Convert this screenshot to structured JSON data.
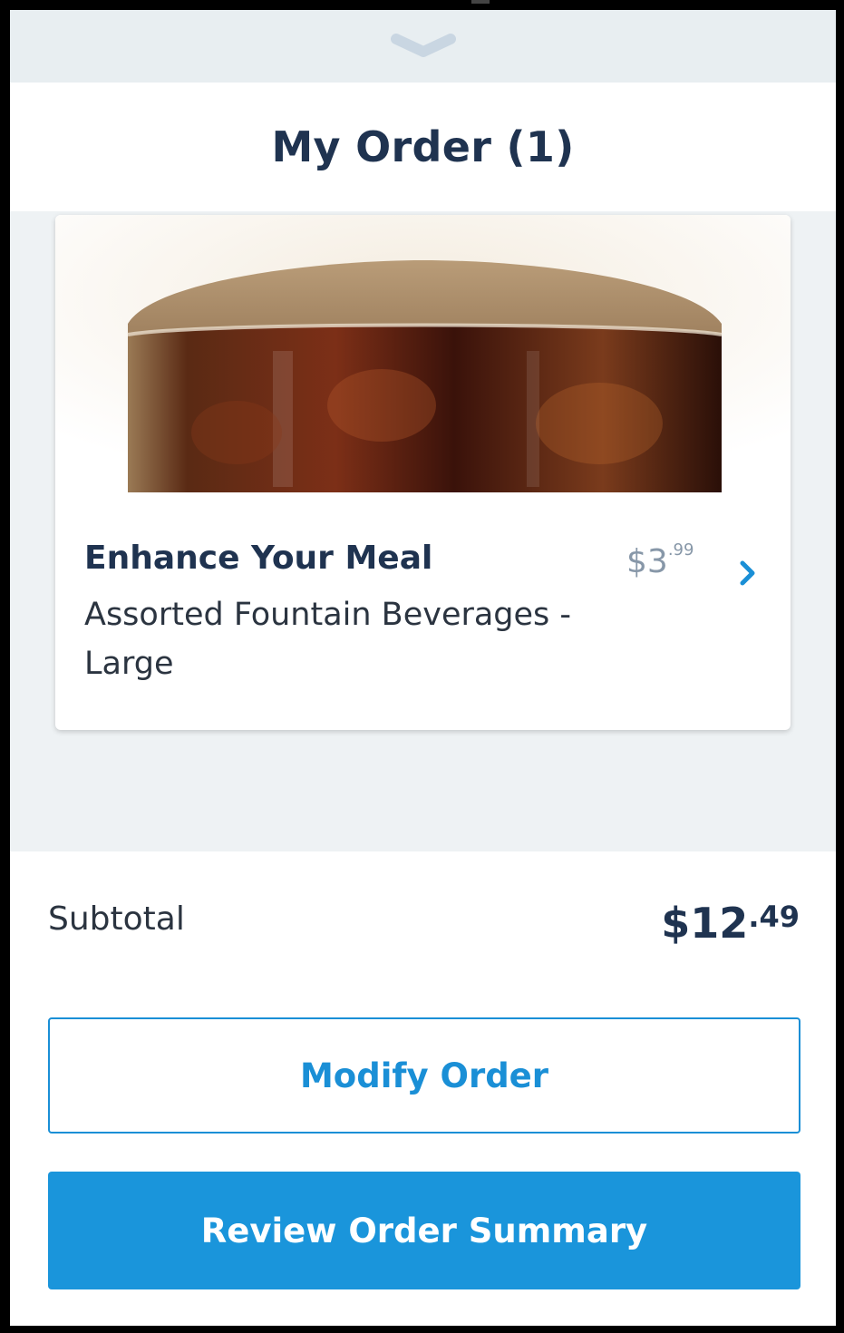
{
  "header": {
    "title": "My Order (1)"
  },
  "order_items": [
    {
      "title": "Enhance Your Meal",
      "description": "Assorted Fountain Beverages - Large",
      "price_dollars": "$3",
      "price_cents": ".99",
      "image": "fountain-beverage-photo"
    }
  ],
  "summary": {
    "subtotal_label": "Subtotal",
    "subtotal_dollars": "$12",
    "subtotal_cents": ".49"
  },
  "actions": {
    "modify_label": "Modify Order",
    "review_label": "Review Order Summary"
  },
  "colors": {
    "accent": "#1a95db",
    "heading": "#1f3350",
    "background": "#eef2f4"
  }
}
